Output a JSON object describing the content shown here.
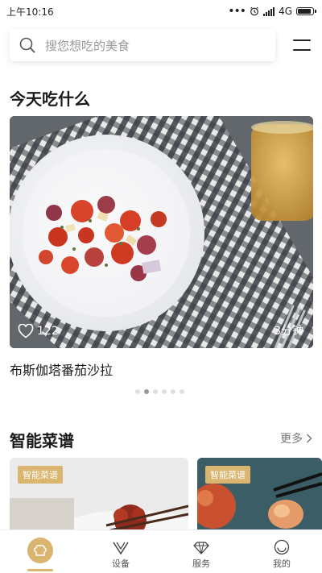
{
  "status_bar": {
    "time": "上午10:16",
    "network": "4G",
    "battery_level": 0.9
  },
  "search": {
    "placeholder": "搜您想吃的美食"
  },
  "today": {
    "title": "今天吃什么",
    "recipe": {
      "name": "布斯伽塔番茄沙拉",
      "likes": "122",
      "time": "3分钟"
    },
    "carousel": {
      "count": 6,
      "active_index": 1
    }
  },
  "smart": {
    "title": "智能菜谱",
    "more_label": "更多",
    "cards": [
      {
        "tag": "智能菜谱"
      },
      {
        "tag": "智能菜谱"
      }
    ]
  },
  "nav": {
    "items": [
      {
        "label": "",
        "icon": "chef-hat-icon",
        "active": true
      },
      {
        "label": "设备",
        "icon": "v-device-icon"
      },
      {
        "label": "服务",
        "icon": "diamond-icon"
      },
      {
        "label": "我的",
        "icon": "profile-icon"
      }
    ]
  },
  "colors": {
    "accent": "#d9b56f",
    "text": "#1a1a1a",
    "muted": "#9a9a9a"
  }
}
